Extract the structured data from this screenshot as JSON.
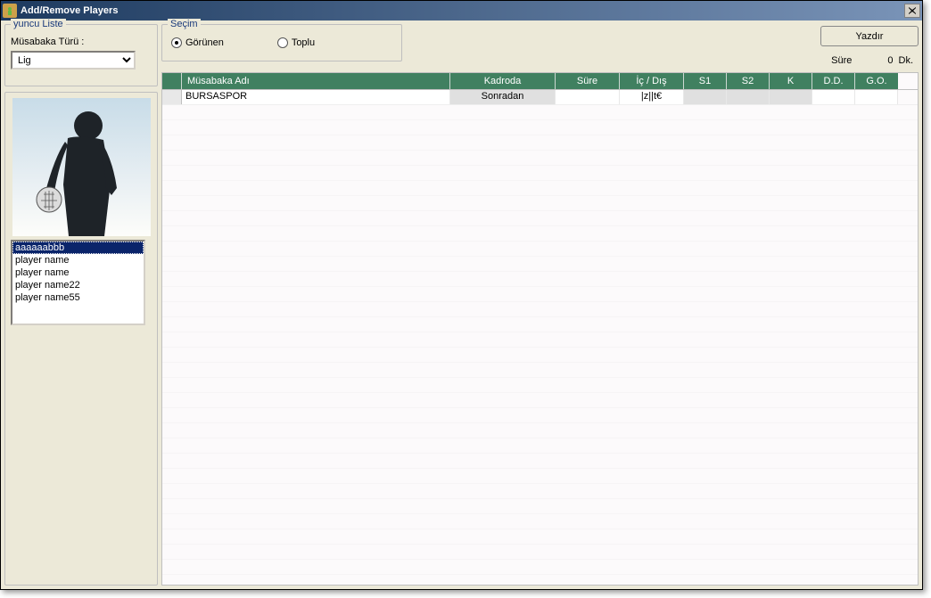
{
  "window_title": "Add/Remove Players",
  "left": {
    "group_title": "yuncu Liste",
    "type_label": "Müsabaka Türü :",
    "type_value": "Lig",
    "players": [
      "aaaaaabbb",
      "player name",
      "player name",
      "player name22",
      "player name55"
    ],
    "selected_index": 0
  },
  "selection": {
    "group_title": "Seçim",
    "option_visible": "Görünen",
    "option_total": "Toplu",
    "selected": "visible"
  },
  "print_label": "Yazdır",
  "duration": {
    "label": "Süre",
    "value": "0",
    "unit": "Dk."
  },
  "grid": {
    "columns": [
      "Müsabaka Adı",
      "Kadroda",
      "Süre",
      "İç / Dış",
      "S1",
      "S2",
      "K",
      "D.D.",
      "G.O."
    ],
    "row": {
      "name": "BURSASPOR",
      "kadroda": "Sonradan",
      "sure": "",
      "icdis": "|z||t€",
      "s1": "",
      "s2": "",
      "k": "",
      "dd": "",
      "go": ""
    }
  }
}
